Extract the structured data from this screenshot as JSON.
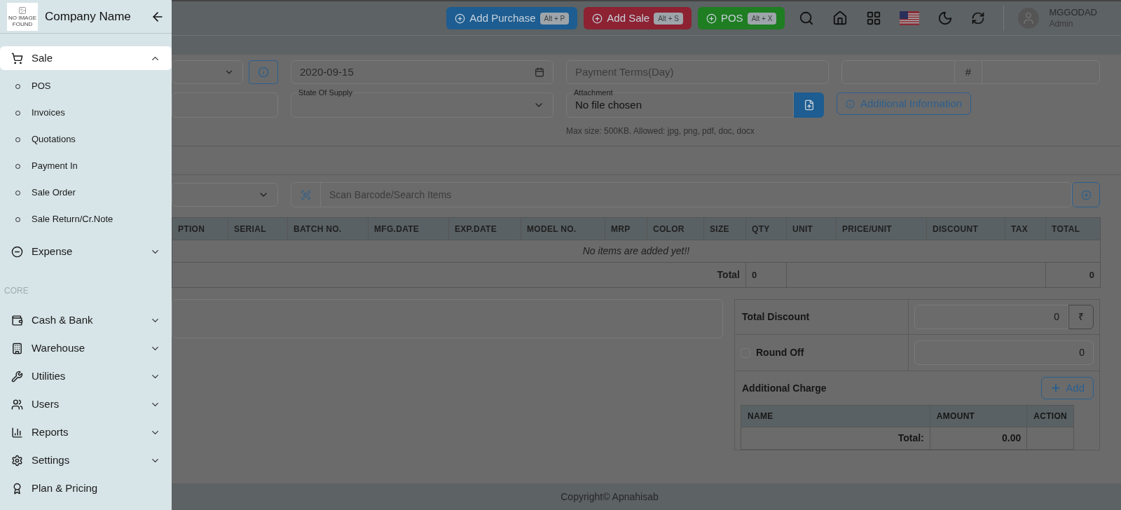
{
  "sidebar": {
    "company_name": "Company Name",
    "logo_text": "NO IMAGE FOUND",
    "items": [
      {
        "kind": "group",
        "label": "Sale",
        "expanded": true,
        "selected": true,
        "children": [
          {
            "label": "POS"
          },
          {
            "label": "Invoices"
          },
          {
            "label": "Quotations"
          },
          {
            "label": "Payment In"
          },
          {
            "label": "Sale Order"
          },
          {
            "label": "Sale Return/Cr.Note"
          }
        ]
      },
      {
        "kind": "group",
        "label": "Expense",
        "expanded": false,
        "selected": false
      },
      {
        "kind": "section",
        "label": "CORE"
      },
      {
        "kind": "group",
        "label": "Cash & Bank",
        "expanded": false,
        "selected": false
      },
      {
        "kind": "group",
        "label": "Warehouse",
        "expanded": false,
        "selected": false
      },
      {
        "kind": "group",
        "label": "Utilities",
        "expanded": false,
        "selected": false
      },
      {
        "kind": "group",
        "label": "Users",
        "expanded": false,
        "selected": false
      },
      {
        "kind": "group",
        "label": "Reports",
        "expanded": false,
        "selected": false
      },
      {
        "kind": "group",
        "label": "Settings",
        "expanded": false,
        "selected": false
      },
      {
        "kind": "link",
        "label": "Plan & Pricing",
        "selected": false
      }
    ]
  },
  "header": {
    "buttons": [
      {
        "label": "Add Purchase",
        "shortcut": "Alt + P",
        "color": "#1d5d91"
      },
      {
        "label": "Add Sale",
        "shortcut": "Alt + S",
        "color": "#8c2232"
      },
      {
        "label": "POS",
        "shortcut": "Alt + X",
        "color": "#1f7d22"
      }
    ],
    "user": {
      "name": "MGGODAD",
      "role": "Admin"
    }
  },
  "form": {
    "date": "2020-09-15",
    "payment_terms_placeholder": "Payment Terms(Day)",
    "number_prefix": "#",
    "state_of_supply_label": "State Of Supply",
    "attachment_label": "Attachment",
    "attachment_value": "No file chosen",
    "additional_info_button": "Additional Information",
    "attachment_hint": "Max size: 500KB. Allowed: jpg, png, pdf, doc, docx",
    "search_placeholder": "Scan Barcode/Search Items"
  },
  "items_table": {
    "columns": [
      "PTION",
      "SERIAL",
      "BATCH NO.",
      "MFG.DATE",
      "EXP.DATE",
      "MODEL NO.",
      "MRP",
      "COLOR",
      "SIZE",
      "QTY",
      "UNIT",
      "PRICE/UNIT",
      "DISCOUNT",
      "TAX",
      "TOTAL"
    ],
    "empty_message": "No items are added yet!!",
    "total_label": "Total",
    "total_qty": "0",
    "total_amount": "0"
  },
  "summary": {
    "total_discount_label": "Total Discount",
    "total_discount_value": "0",
    "currency_symbol": "₹",
    "round_off_label": "Round Off",
    "round_off_checked": false,
    "round_off_value": "0",
    "additional_charge_label": "Additional Charge",
    "add_button": "Add",
    "charges_table": {
      "columns": [
        "NAME",
        "AMOUNT",
        "ACTION"
      ],
      "total_label": "Total:",
      "total_value": "0.00"
    }
  },
  "footer": {
    "copyright": "Copyright© Apnahisab"
  }
}
